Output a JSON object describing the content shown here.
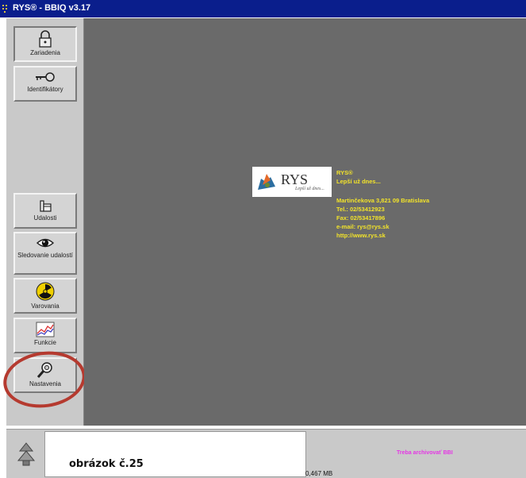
{
  "window": {
    "title": "RYS® - BBIQ v3.17"
  },
  "sidebar": {
    "buttons": [
      {
        "label": "Zariadenia",
        "icon": "padlock-icon"
      },
      {
        "label": "Identifikátory",
        "icon": "key-icon"
      },
      {
        "label": "Udalosti",
        "icon": "hand-icon"
      },
      {
        "label": "Sledovanie udalostí",
        "icon": "eye-icon"
      },
      {
        "label": "Varovania",
        "icon": "radiation-icon"
      },
      {
        "label": "Funkcie",
        "icon": "chart-icon"
      },
      {
        "label": "Nastavenia",
        "icon": "wrench-icon"
      }
    ]
  },
  "splash": {
    "logo_text": "RYS",
    "logo_slogan": "Lepší už dnes...",
    "company": "RYS®",
    "slogan": "Lepší už dnes...",
    "address": "Martinčekova 3,821 09 Bratislava",
    "tel": "Tel.: 02/53412923",
    "fax": "Fax: 02/53417896",
    "email": "e-mail: rys@rys.sk",
    "web": "http://www.rys.sk"
  },
  "status": {
    "caption": "obrázok č.25",
    "archive_message": "Treba archivovať BBI",
    "size": "0,467 MB"
  },
  "colors": {
    "titlebar": "#0a1e8c",
    "info_text": "#f2e32a",
    "archive_text": "#e536e5",
    "highlight_circle": "#b53a2f"
  }
}
